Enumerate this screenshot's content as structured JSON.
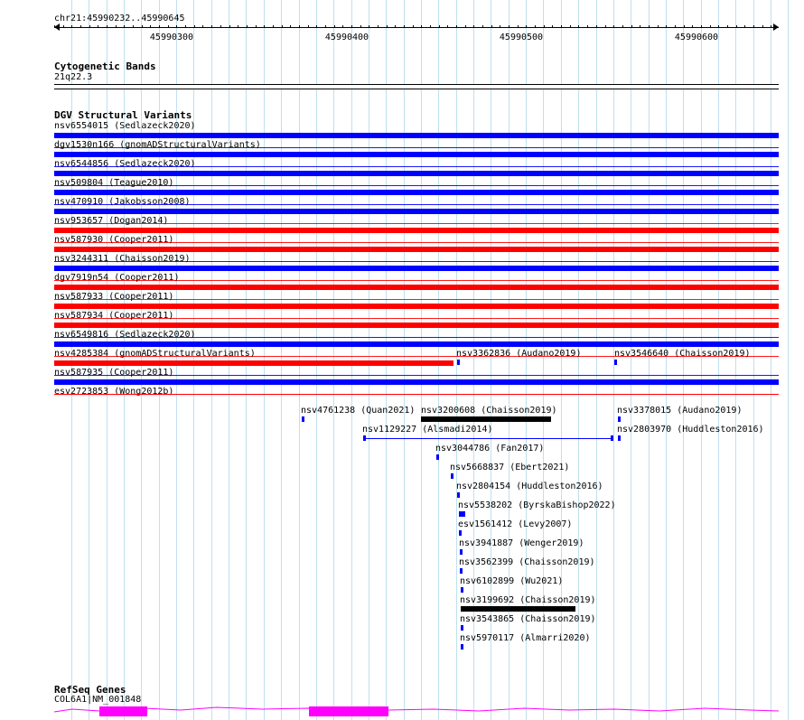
{
  "ruler": {
    "title": "chr21:45990232..45990645",
    "ticks": [
      "45990300",
      "45990400",
      "45990500",
      "45990600"
    ]
  },
  "cytoband": {
    "title": "Cytogenetic Bands",
    "band": "21q22.3"
  },
  "dgv": {
    "title": "DGV Structural Variants",
    "colors": {
      "loss": "#ff0000",
      "gain": "#0000ff",
      "complex": "#000000"
    },
    "full_rows": [
      {
        "label": "nsv6554015 (Sedlazeck2020)",
        "color": "#0000ff"
      },
      {
        "label": "dgv1530n166 (gnomADStructuralVariants)",
        "color": "#0000ff"
      },
      {
        "label": "nsv6544856 (Sedlazeck2020)",
        "color": "#0000ff"
      },
      {
        "label": "nsv509804 (Teague2010)",
        "color": "#0000ff"
      },
      {
        "label": "nsv470910 (Jakobsson2008)",
        "color": "#0000ff"
      },
      {
        "label": "nsv953657 (Dogan2014)",
        "color": "#ff0000"
      },
      {
        "label": "nsv587930 (Cooper2011)",
        "color": "#ff0000"
      },
      {
        "label": "nsv3244311 (Chaisson2019)",
        "color": "#0000ff"
      },
      {
        "label": "dgv7919n54 (Cooper2011)",
        "color": "#ff0000"
      },
      {
        "label": "nsv587933 (Cooper2011)",
        "color": "#ff0000"
      },
      {
        "label": "nsv587934 (Cooper2011)",
        "color": "#ff0000"
      },
      {
        "label": "nsv6549816 (Sedlazeck2020)",
        "color": "#0000ff"
      },
      {
        "label": "nsv4285384 (gnomADStructuralVariants)",
        "color": "#ff0000"
      },
      {
        "label": "nsv587935 (Cooper2011)",
        "color": "#0000ff"
      },
      {
        "label": "esv2723853 (Wong2012b)",
        "color": "#ff0000"
      }
    ],
    "side_items": [
      {
        "label": "nsv3362836 (Audano2019)",
        "color": "#0000ff"
      },
      {
        "label": "nsv3546640 (Chaisson2019)",
        "color": "#0000ff"
      }
    ],
    "small_items": [
      {
        "label": "nsv4761238 (Quan2021)",
        "color": "#0000ff"
      },
      {
        "label": "nsv3200608 (Chaisson2019)",
        "color": "#000000"
      },
      {
        "label": "nsv3378015 (Audano2019)",
        "color": "#0000ff"
      },
      {
        "label": "nsv1129227 (Alsmadi2014)",
        "color": "#0000ff"
      },
      {
        "label": "nsv2803970 (Huddleston2016)",
        "color": "#0000ff"
      },
      {
        "label": "nsv3044786 (Fan2017)",
        "color": "#0000ff"
      },
      {
        "label": "nsv5668837 (Ebert2021)",
        "color": "#0000ff"
      },
      {
        "label": "nsv2804154 (Huddleston2016)",
        "color": "#0000ff"
      },
      {
        "label": "nsv5538202 (ByrskaBishop2022)",
        "color": "#0000ff"
      },
      {
        "label": "esv1561412 (Levy2007)",
        "color": "#0000ff"
      },
      {
        "label": "nsv3941887 (Wenger2019)",
        "color": "#0000ff"
      },
      {
        "label": "nsv3562399 (Chaisson2019)",
        "color": "#0000ff"
      },
      {
        "label": "nsv6102899 (Wu2021)",
        "color": "#0000ff"
      },
      {
        "label": "nsv3199692 (Chaisson2019)",
        "color": "#000000"
      },
      {
        "label": "nsv3543865 (Chaisson2019)",
        "color": "#0000ff"
      },
      {
        "label": "nsv5970117 (Almarri2020)",
        "color": "#0000ff"
      }
    ]
  },
  "refseq": {
    "title": "RefSeq Genes",
    "gene": "COL6A1|NM_001848",
    "color": "#ff00ff"
  }
}
